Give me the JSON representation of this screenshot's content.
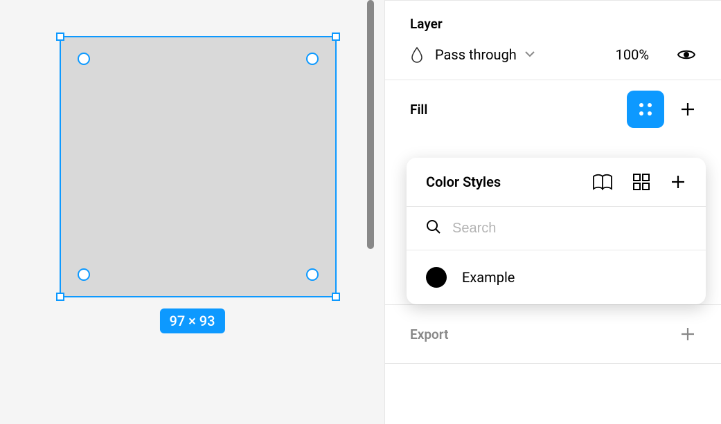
{
  "canvas": {
    "selection_size_label": "97 × 93"
  },
  "panel": {
    "layer": {
      "title": "Layer",
      "blend_mode": "Pass through",
      "opacity": "100%"
    },
    "fill": {
      "title": "Fill"
    },
    "export": {
      "title": "Export"
    }
  },
  "color_styles_popover": {
    "title": "Color Styles",
    "search_placeholder": "Search",
    "items": [
      {
        "name": "Example",
        "swatch_color": "#000000"
      }
    ]
  }
}
